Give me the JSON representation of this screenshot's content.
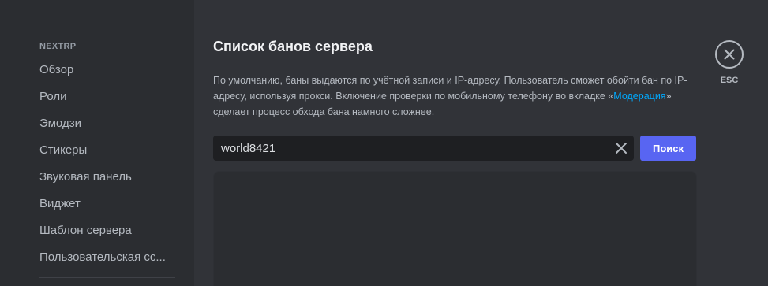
{
  "sidebar": {
    "server_name": "NEXTRP",
    "items": [
      {
        "label": "Обзор"
      },
      {
        "label": "Роли"
      },
      {
        "label": "Эмодзи"
      },
      {
        "label": "Стикеры"
      },
      {
        "label": "Звуковая панель"
      },
      {
        "label": "Виджет"
      },
      {
        "label": "Шаблон сервера"
      },
      {
        "label": "Пользовательская сс..."
      }
    ]
  },
  "main": {
    "title": "Список банов сервера",
    "description": {
      "before_link": "По умолчанию, баны выдаются по учётной записи и IP-адресу. Пользователь сможет обойти бан по IP-адресу, используя прокси. Включение проверки по мобильному телефону во вкладке «",
      "link_text": "Модерация",
      "after_link": "» сделает процесс обхода бана намного сложнее."
    },
    "search": {
      "value": "world8421",
      "button_label": "Поиск"
    }
  },
  "close": {
    "esc_label": "ESC"
  },
  "icons": {
    "clear": "close-icon",
    "close": "close-icon"
  },
  "colors": {
    "sidebar_bg": "#2b2d31",
    "main_bg": "#313338",
    "accent": "#5865f2",
    "link": "#00a8fc"
  }
}
